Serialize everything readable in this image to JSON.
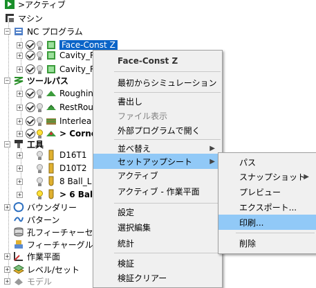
{
  "tree": {
    "active": ">アクティブ",
    "machine": "マシン",
    "nc_program": "NC プログラム",
    "nc_items": [
      "Face-Const Z",
      "Cavity_R",
      "Cavity_R"
    ],
    "toolpath": "ツールパス",
    "toolpath_items": [
      "Roughin",
      "RestRou",
      "Interlea",
      "> Corne"
    ],
    "tool": "工具",
    "tool_items": [
      "D16T1",
      "D10T2",
      "8 Ball_L",
      "> 6 Ball"
    ],
    "boundary": "バウンダリー",
    "pattern": "パターン",
    "hole_feature": "孔フィーチャーセット",
    "feature_group": "フィーチャーグループ",
    "workplane": "作業平面",
    "level_set": "レベル/セット",
    "model": "モデル"
  },
  "context_menu": {
    "title": "Face-Const Z",
    "simulate": "最初からシミュレーション",
    "write": "書出し",
    "show_file": "ファイル表示",
    "open_external": "外部プログラムで開く",
    "sort": "並べ替え",
    "setup_sheet": "セットアップシート",
    "activate": "アクティブ",
    "activate_workplane": "アクティブ - 作業平面",
    "settings": "設定",
    "select_edit": "選択編集",
    "statistics": "統計",
    "verify": "検証",
    "verify_clear": "検証クリアー"
  },
  "submenu": {
    "path": "パス",
    "snapshot": "スナップショット",
    "preview": "プレビュー",
    "export": "エクスポート...",
    "print": "印刷...",
    "delete": "削除"
  },
  "colors": {
    "selection": "#0a64c8",
    "menu_highlight": "#91c9f7",
    "menu_bg": "#f0f0f0"
  }
}
